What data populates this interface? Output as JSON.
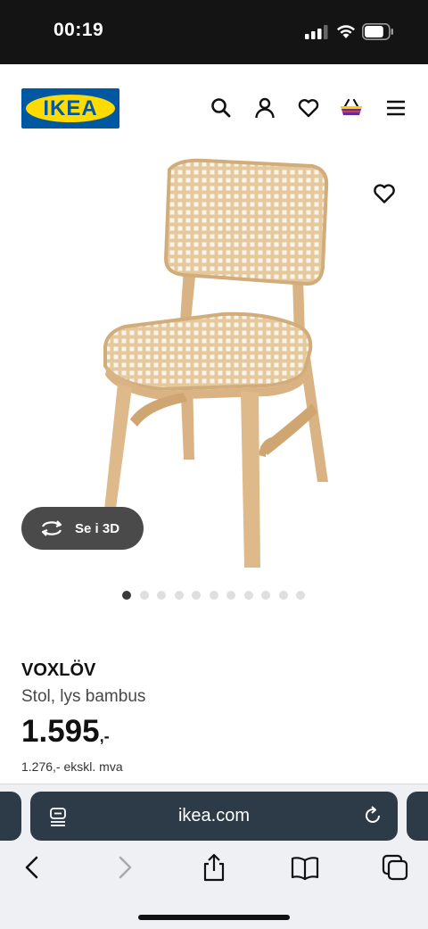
{
  "status_bar": {
    "time": "00:19",
    "battery_level": 0.8
  },
  "header": {
    "logo_text": "IKEA",
    "icons": [
      "search-icon",
      "account-icon",
      "wishlist-heart-icon",
      "shopping-basket-icon",
      "menu-icon"
    ]
  },
  "product": {
    "image_alt": "chair",
    "view_3d_label": "Se i 3D",
    "carousel_count": 11,
    "carousel_active": 1,
    "name": "VOXLÖV",
    "description": "Stol, lys bambus",
    "price": "1.595",
    "price_suffix": ",-",
    "price_ex_vat": "1.276,- ekskl. mva"
  },
  "browser": {
    "url": "ikea.com",
    "toolbar": [
      "back-icon",
      "forward-icon",
      "share-icon",
      "bookmarks-icon",
      "tabs-icon"
    ]
  },
  "colors": {
    "ikea_blue": "#0058a3",
    "ikea_yellow": "#ffdb00",
    "address_bar": "#2d3a48",
    "status_bar": "#141414",
    "chair_wood": "#e8c9a0"
  }
}
